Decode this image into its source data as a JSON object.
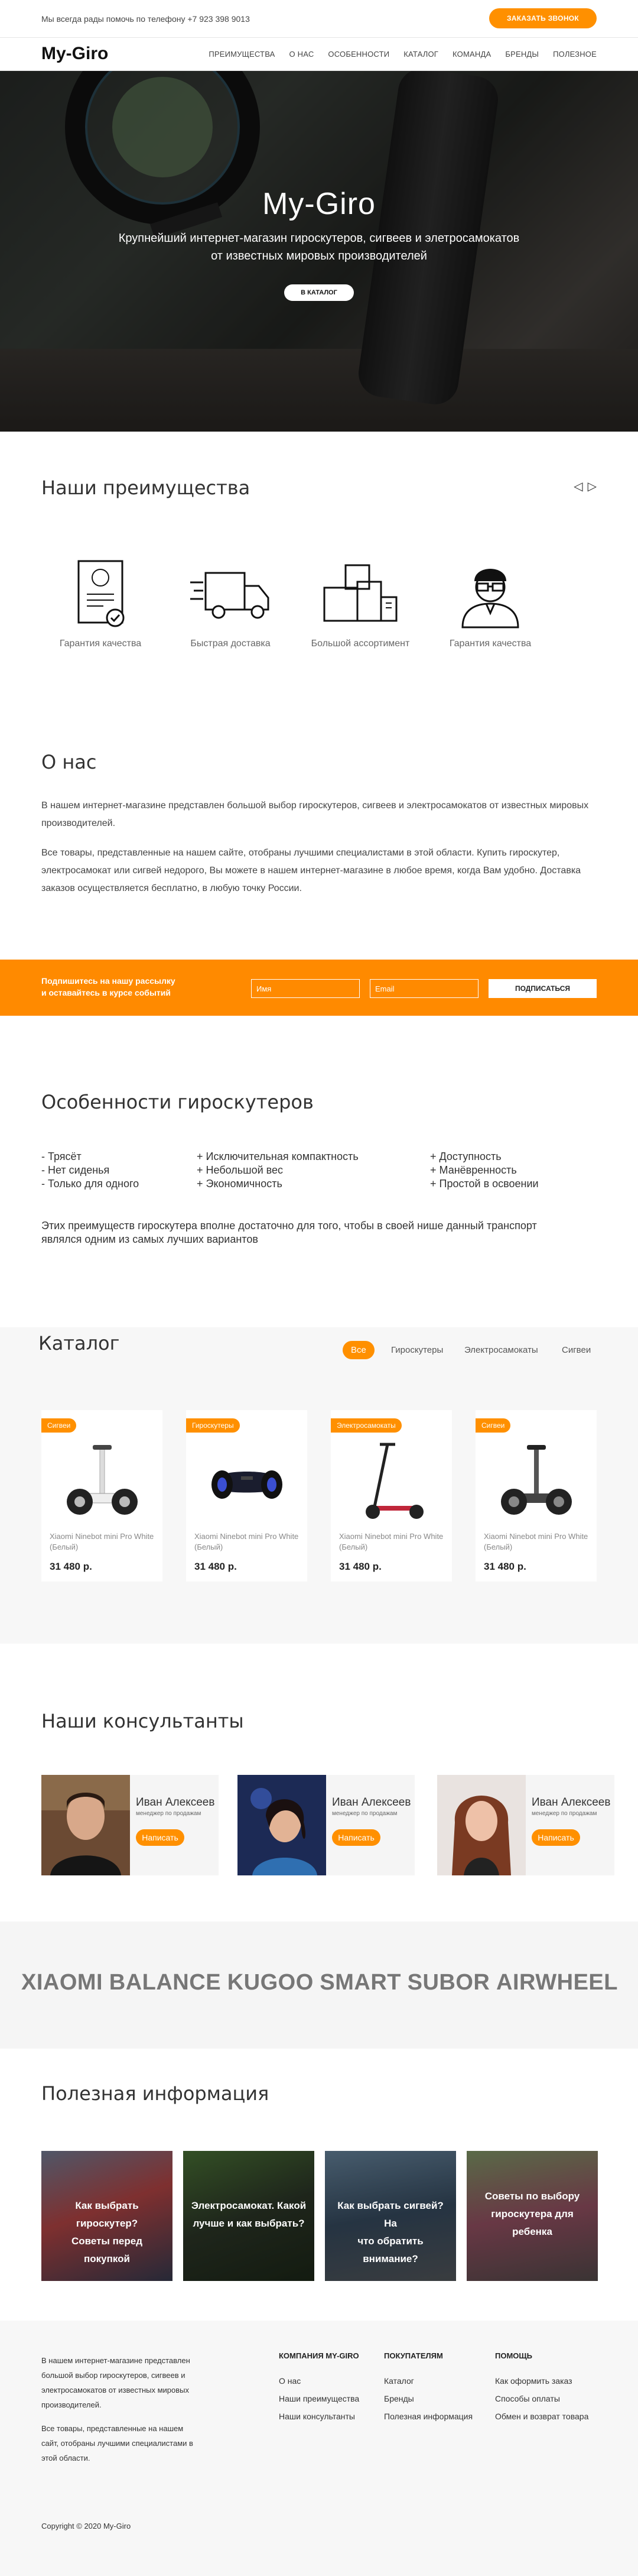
{
  "topbar": {
    "phone_text": "Мы всегда рады помочь по телефону +7 923 398 9013",
    "call_button": "Заказать звонок"
  },
  "nav": {
    "logo": "My-Giro",
    "items": [
      "Преимущества",
      "О нас",
      "Особенности",
      "Каталог",
      "Команда",
      "Бренды",
      "Полезное"
    ]
  },
  "hero": {
    "title": "My-Giro",
    "subtitle_line1": "Крупнейший интернет-магазин гироскутеров, сигвеев и элетросамокатов",
    "subtitle_line2": "от известных мировых производителей",
    "button": "В каталог"
  },
  "advantages": {
    "title": "Наши преимущества",
    "prev_arrow": "◁",
    "next_arrow": "▷",
    "items": [
      {
        "icon": "certificate-icon",
        "label": "Гарантия качества"
      },
      {
        "icon": "delivery-truck-icon",
        "label": "Быстрая доставка"
      },
      {
        "icon": "boxes-icon",
        "label": "Большой ассортимент"
      },
      {
        "icon": "specialist-icon",
        "label": "Гарантия качества"
      }
    ]
  },
  "about": {
    "title": "О нас",
    "p1": "В нашем интернет-магазине представлен большой выбор гироскутеров, сигвеев и электросамокатов от известных мировых производителей.",
    "p2": "Все товары, представленные на нашем сайте, отобраны лучшими специалистами в этой области. Купить гироскутер, электросамокат или сигвей недорого, Вы можете в нашем интернет-магазине в любое время, когда Вам удобно. Доставка заказов осуществляется бесплатно, в любую точку России."
  },
  "subscribe": {
    "text_line1": "Подпишитесь на нашу рассылку",
    "text_line2": "и оставайтесь в курсе событий",
    "name_placeholder": "Имя",
    "email_placeholder": "Email",
    "button": "Подписаться"
  },
  "features": {
    "title": "Особенности гироскутеров",
    "col1": [
      "- Трясёт",
      "- Нет сиденья",
      "- Только для одного"
    ],
    "col2": [
      "+ Исключительная компактность",
      "+ Небольшой вес",
      "+ Экономичность"
    ],
    "col3": [
      "+ Доступность",
      "+ Манёвренность",
      "+ Простой в освоении"
    ],
    "summary_line1": "Этих преимуществ гироскутера вполне достаточно для того, чтобы в своей нише данный транспорт",
    "summary_line2": "являлся одним из самых лучших вариантов"
  },
  "catalog": {
    "title": "Каталог",
    "filters": [
      "Все",
      "Гироскутеры",
      "Электросамокаты",
      "Сигвеи"
    ],
    "products": [
      {
        "badge": "Сигвеи",
        "name": "Xiaomi Ninebot mini Pro White (Белый)",
        "price": "31 480 р."
      },
      {
        "badge": "Гироскутеры",
        "name": "Xiaomi Ninebot mini Pro White (Белый)",
        "price": "31 480 р."
      },
      {
        "badge": "Электросамокаты",
        "name": "Xiaomi Ninebot mini Pro White (Белый)",
        "price": "31 480 р."
      },
      {
        "badge": "Сигвеи",
        "name": "Xiaomi Ninebot mini Pro White (Белый)",
        "price": "31 480 р."
      }
    ]
  },
  "consultants": {
    "title": "Наши консультанты",
    "people": [
      {
        "name": "Иван Алексеев",
        "role": "менеджер по продажам",
        "button": "Написать"
      },
      {
        "name": "Иван Алексеев",
        "role": "менеджер по продажам",
        "button": "Написать"
      },
      {
        "name": "Иван Алексеев",
        "role": "менеджер по продажам",
        "button": "Написать"
      }
    ]
  },
  "brands": [
    "XIAOMI",
    "BALANCE",
    "KUGOO",
    "SMART",
    "SUBOR",
    "AIRWHEEL"
  ],
  "useful": {
    "title": "Полезная информация",
    "articles": [
      {
        "line1": "Как выбрать гироскутер?",
        "line2": "Советы перед покупкой"
      },
      {
        "line1": "Электросамокат. Какой",
        "line2": "лучше и как выбрать?"
      },
      {
        "line1": "Как выбрать сигвей? На",
        "line2": "что обратить внимание?"
      },
      {
        "line1": "Советы по выбору",
        "line2": "гироскутера для",
        "line3": "ребенка"
      }
    ]
  },
  "footer": {
    "about_p1_lines": [
      "В нашем интернет-магазине представлен",
      "большой выбор гироскутеров, сигвеев и",
      "электросамокатов от известных мировых",
      "производителей."
    ],
    "about_p2_lines": [
      "Все товары, представленные на нашем",
      "сайт, отобраны лучшими специалистами в",
      "этой области."
    ],
    "columns": [
      {
        "title": "Компания My-Giro",
        "links": [
          "О нас",
          "Наши преимущества",
          "Наши консультанты"
        ]
      },
      {
        "title": "Покупателям",
        "links": [
          "Каталог",
          "Бренды",
          "Полезная информация"
        ]
      },
      {
        "title": "Помощь",
        "links": [
          "Как оформить заказ",
          "Способы оплаты",
          "Обмен и возврат товара"
        ]
      }
    ],
    "copyright": "Copyright © 2020 My-Giro"
  },
  "colors": {
    "accent": "#ff9000",
    "subscribe_bg": "#ff8a00"
  }
}
